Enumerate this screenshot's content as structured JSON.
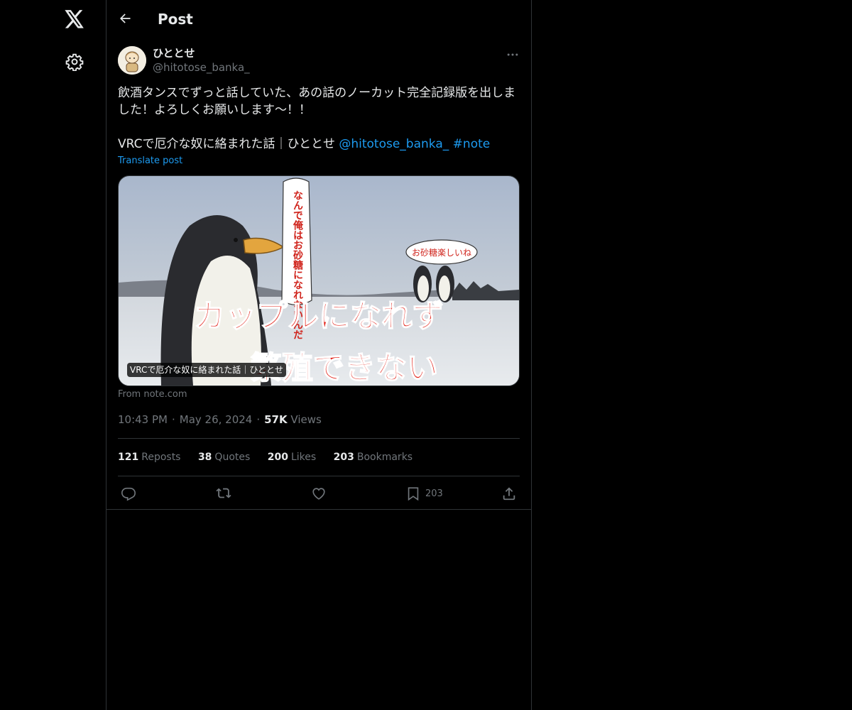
{
  "header": {
    "title": "Post"
  },
  "author": {
    "display_name": "ひととせ",
    "handle": "@hitotose_banka_"
  },
  "post": {
    "text_line1": "飲酒タンスでずっと話していた、あの話のノーカット完全記録版を出しま",
    "text_line2": "した！よろしくお願いします〜！！",
    "link_line_prefix": "VRCで厄介な奴に絡まれた話｜ひととせ ",
    "mention": "@hitotose_banka_",
    "hashtag": "#note",
    "translate_label": "Translate post"
  },
  "card": {
    "image_text_big1": "カップルになれず",
    "image_text_big2": "繁殖できない",
    "image_text_vertical": "なんで俺はお砂糖になれないんだ",
    "image_text_bubble": "お砂糖楽しいね",
    "caption": "VRCで厄介な奴に絡まれた話｜ひととせ",
    "source": "From note.com"
  },
  "meta": {
    "time": "10:43 PM",
    "date": "May 26, 2024",
    "views_count": "57K",
    "views_label": "Views"
  },
  "stats": [
    {
      "num": "121",
      "label": "Reposts"
    },
    {
      "num": "38",
      "label": "Quotes"
    },
    {
      "num": "200",
      "label": "Likes"
    },
    {
      "num": "203",
      "label": "Bookmarks"
    }
  ],
  "actions": {
    "bookmark_count": "203"
  },
  "colors": {
    "background": "#000000",
    "text": "#e7e9ea",
    "muted": "#71767b",
    "accent": "#1d9bf0",
    "border": "#2f3336"
  },
  "icons": [
    "x-logo-icon",
    "gear-icon",
    "back-arrow-icon",
    "more-icon",
    "reply-icon",
    "repost-icon",
    "like-icon",
    "bookmark-icon",
    "share-icon"
  ]
}
